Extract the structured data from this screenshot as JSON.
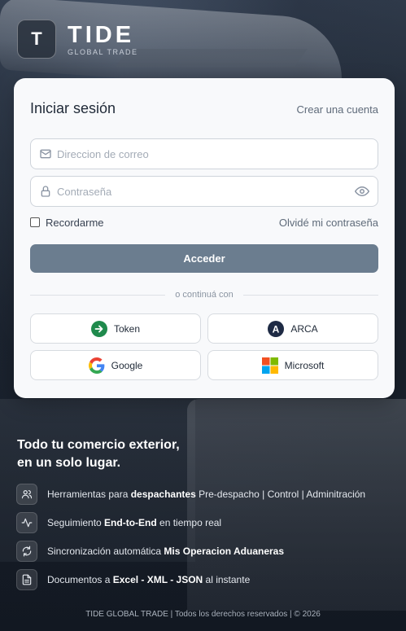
{
  "brand": {
    "logo_letter": "T",
    "name": "TIDE",
    "subtitle": "GLOBAL TRADE"
  },
  "login": {
    "title": "Iniciar sesión",
    "create_account": "Crear una cuenta",
    "email_placeholder": "Direccion de correo",
    "password_placeholder": "Contraseña",
    "remember_label": "Recordarme",
    "remember_checked": false,
    "forgot_password": "Olvidé mi contraseña",
    "submit_label": "Acceder",
    "divider_text": "o continuá con",
    "providers": {
      "token": "Token",
      "arca": "ARCA",
      "arca_letter": "A",
      "google": "Google",
      "microsoft": "Microsoft"
    }
  },
  "tagline": {
    "line1": "Todo tu comercio exterior,",
    "line2": "en un solo lugar."
  },
  "features": [
    {
      "icon": "users-icon",
      "pre": "Herramientas para ",
      "bold": "despachantes",
      "post": " Pre-despacho | Control | Adminitración"
    },
    {
      "icon": "activity-icon",
      "pre": "Seguimiento ",
      "bold": "End-to-End",
      "post": " en tiempo real"
    },
    {
      "icon": "sync-icon",
      "pre": "Sincronización automática ",
      "bold": "Mis Operacion Aduaneras",
      "post": ""
    },
    {
      "icon": "document-icon",
      "pre": "Documentos a ",
      "bold": "Excel - XML - JSON",
      "post": " al instante"
    }
  ],
  "footer": {
    "text": "TIDE GLOBAL TRADE  |  Todos los derechos reservados  |  © 2026"
  },
  "colors": {
    "primary_button": "#6b7d8f",
    "card_bg": "#f8f9fb",
    "token_green": "#1f8a4c",
    "arca_navy": "#1e2a44"
  }
}
